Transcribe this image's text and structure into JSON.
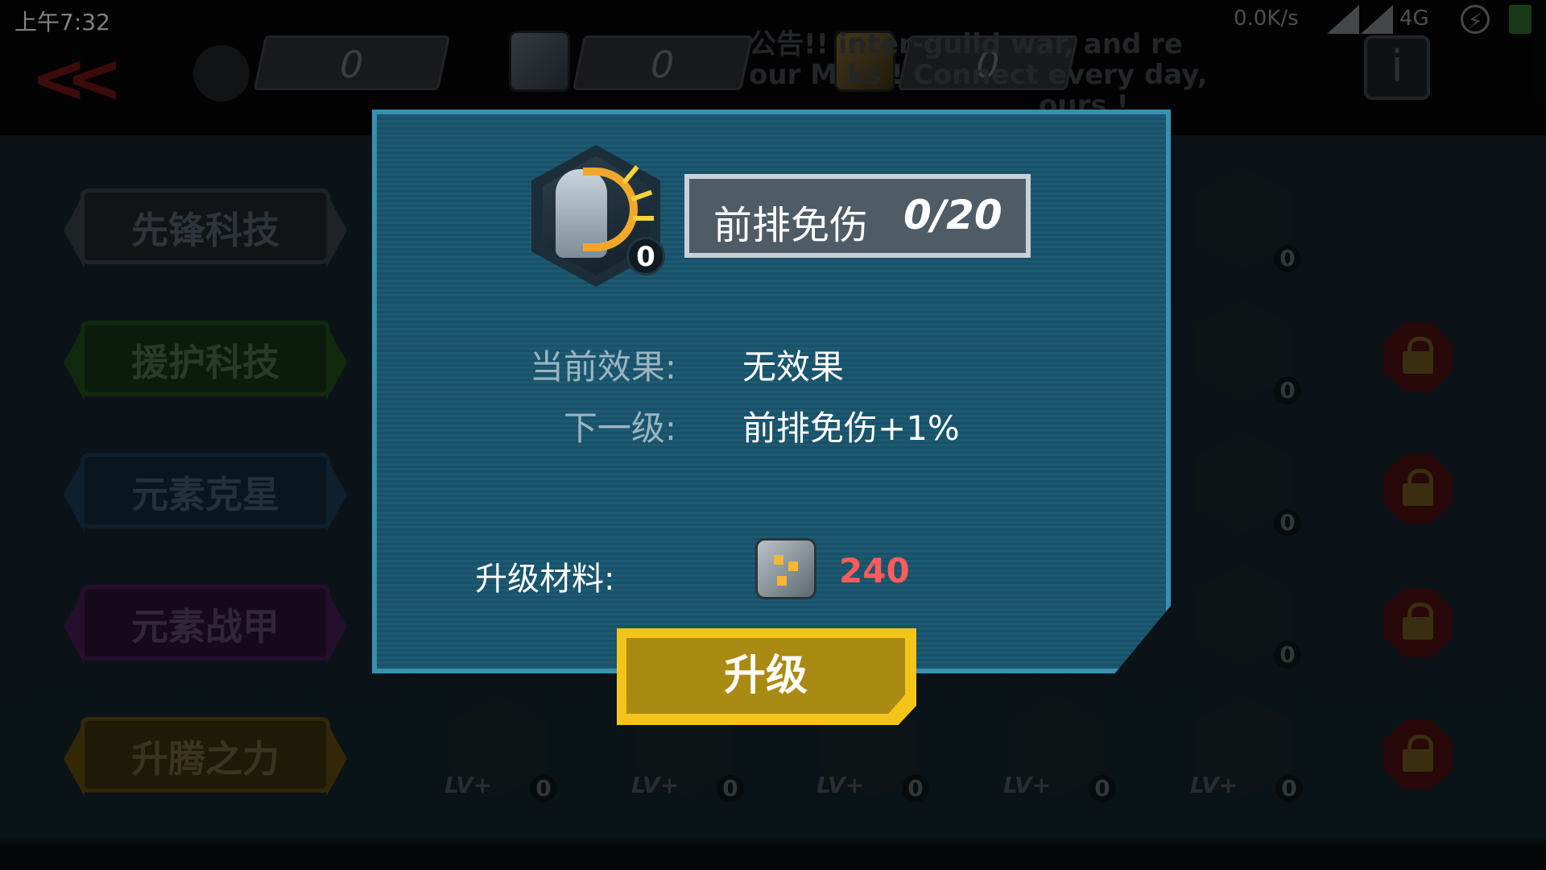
{
  "status_bar": {
    "time": "上午7:32",
    "net_speed": "0.0K/s",
    "network": "4G"
  },
  "top": {
    "resources": [
      {
        "icon": "token-icon",
        "value": "0"
      },
      {
        "icon": "silver-cube-icon",
        "value": "0"
      },
      {
        "icon": "gold-cube-icon",
        "value": "0"
      }
    ],
    "news_line1": "公告!! inter-guild war, and re",
    "news_line2": "our M        ks ! Connect every day,",
    "news_line3": "ours !"
  },
  "categories": [
    {
      "label": "先锋科技"
    },
    {
      "label": "援护科技"
    },
    {
      "label": "元素克星"
    },
    {
      "label": "元素战甲"
    },
    {
      "label": "升腾之力"
    }
  ],
  "skill_grid": {
    "right_column_levels": [
      "0",
      "0",
      "0",
      "0",
      "0"
    ],
    "bottom_row": [
      {
        "icon": "mountain-icon",
        "lv_text": "LV+",
        "level": "0"
      },
      {
        "icon": "fire-icon",
        "lv_text": "LV+",
        "level": "0"
      },
      {
        "icon": "water-icon",
        "lv_text": "LV+",
        "level": "0"
      },
      {
        "icon": "lightning-icon",
        "lv_text": "LV+",
        "level": "0"
      },
      {
        "icon": "vortex-icon",
        "lv_text": "LV+",
        "level": "0"
      }
    ]
  },
  "dialog": {
    "skill_level_badge": "0",
    "skill_name": "前排免伤",
    "skill_progress": "0/20",
    "current_effect_label": "当前效果:",
    "current_effect_value": "无效果",
    "next_level_label": "下一级:",
    "next_level_value": "前排免伤+1%",
    "material_label": "升级材料:",
    "material_amount": "240",
    "upgrade_button": "升级"
  },
  "colors": {
    "panel_blue": "#1c5a72",
    "panel_border": "#3a8fb0",
    "button_yellow": "#f3c51a",
    "cost_red": "#ff5b5b"
  }
}
